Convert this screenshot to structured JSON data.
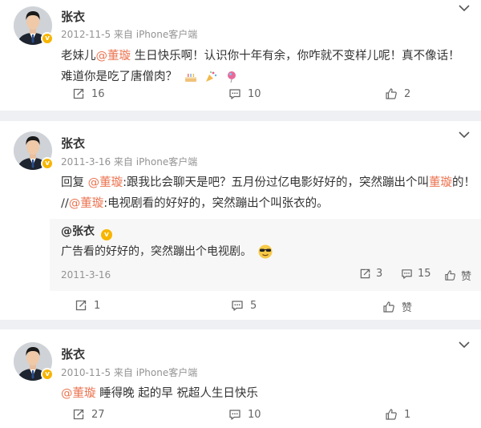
{
  "posts": [
    {
      "author": "张衣",
      "meta": "2012-11-5  来自 iPhone客户端",
      "text_pre": "老妹儿",
      "mention": "@董璇",
      "text_post": " 生日快乐啊！认识你十年有余，你咋就不变样儿呢！真不像话！难道你是吃了唐僧肉？",
      "actions": {
        "repost": "16",
        "comment": "10",
        "like": "2"
      }
    },
    {
      "author": "张衣",
      "meta": "2011-3-16  来自 iPhone客户端",
      "line1_pre": "回复 ",
      "line1_mention": "@董璇",
      "line1_mid": ":跟我比会聊天是吧？五月份过亿电影好好的，突然蹦出个叫",
      "line1_highlight": "董璇",
      "line1_end": "的！",
      "line2_pre": "//",
      "line2_mention": "@董璇",
      "line2_rest": ":电视剧看的好好的，突然蹦出个叫张衣的。",
      "quote": {
        "author": "@张衣",
        "text": "广告看的好好的，突然蹦出个电视剧。",
        "date": "2011-3-16",
        "repost": "3",
        "comment": "15",
        "like": "赞"
      },
      "actions": {
        "repost": "1",
        "comment": "5",
        "like": "赞"
      }
    },
    {
      "author": "张衣",
      "meta": "2010-11-5  来自 iPhone客户端",
      "mention": "@董璇",
      "text_post": " 睡得晚 起的早 祝超人生日快乐",
      "actions": {
        "repost": "27",
        "comment": "10",
        "like": "1"
      }
    }
  ],
  "icons": {
    "verified": "verified-badge-icon",
    "menu": "chevron-down-icon",
    "repost": "repost-icon",
    "comment": "comment-icon",
    "like": "thumbs-up-icon",
    "emoji_row": [
      "cake-icon",
      "party-popper-icon",
      "balloon-icon"
    ],
    "quote_emoji": "sunglasses-face-icon"
  },
  "colors": {
    "mention": "#eb7350",
    "verified": "#f7b500",
    "muted": "#939393"
  }
}
